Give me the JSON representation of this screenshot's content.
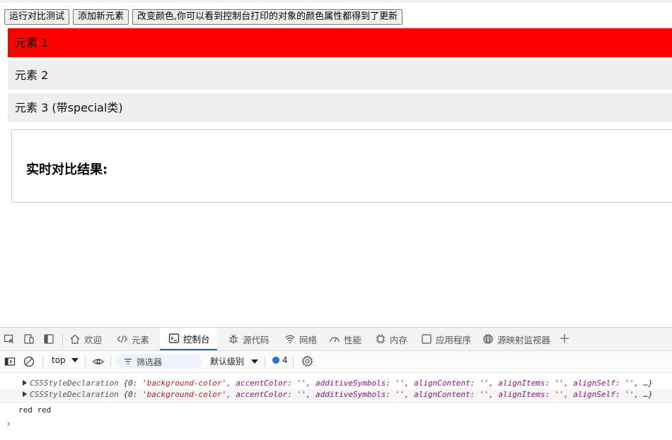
{
  "page": {
    "buttons": {
      "run_compare": "运行对比测试",
      "add_element": "添加新元素",
      "change_color": "改变颜色,你可以看到控制台打印的对象的颜色属性都得到了更新"
    },
    "items": [
      {
        "label": "元素 1"
      },
      {
        "label": "元素 2"
      },
      {
        "label": "元素 3 (带special类)"
      }
    ],
    "result_title": "实时对比结果:",
    "colors": {
      "item1_bg": "#ff0000",
      "item_bg": "#eeeeee"
    }
  },
  "devtools": {
    "tabs": {
      "welcome": "欢迎",
      "elements": "元素",
      "console": "控制台",
      "sources": "源代码",
      "network": "网络",
      "performance": "性能",
      "memory": "内存",
      "application": "应用程序",
      "source_map": "源映射监视器"
    },
    "toolbar": {
      "context": "top",
      "filter": "筛选器",
      "level": "默认级别",
      "issues_count": "4"
    },
    "console": {
      "log_type": "CSSStyleDeclaration",
      "log_body_open": "{0: ",
      "log_k0": "'background-color'",
      "log_p1": ", accentColor: ",
      "log_v1": "''",
      "log_p2": ", additiveSymbols: ",
      "log_v2": "''",
      "log_p3": ", alignContent: ",
      "log_v3": "''",
      "log_p4": ", alignItems: ",
      "log_v4": "''",
      "log_p5": ", alignSelf: ",
      "log_v5": "''",
      "log_tail": ", …}",
      "plain_line": "red red",
      "prompt": "›"
    }
  }
}
